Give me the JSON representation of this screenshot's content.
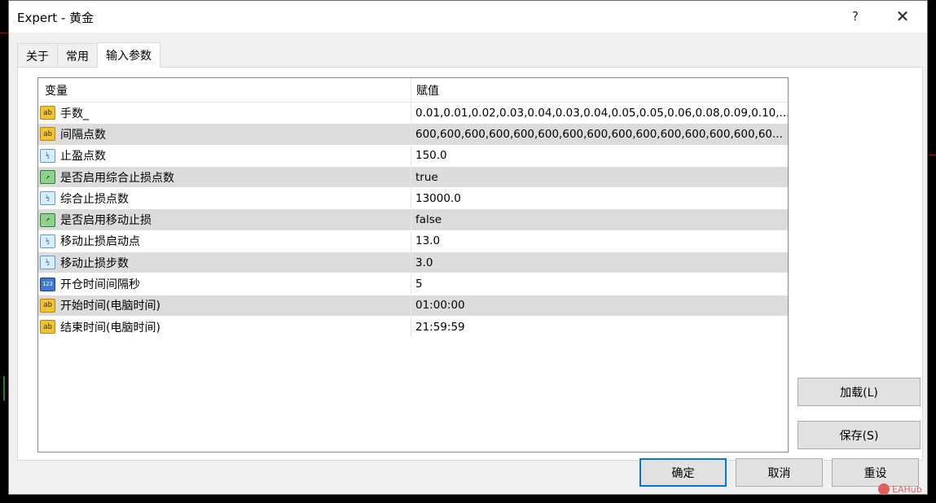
{
  "window": {
    "title": "Expert - 黄金",
    "help_label": "?",
    "close_label": "✕"
  },
  "tabs": [
    {
      "label": "关于"
    },
    {
      "label": "常用"
    },
    {
      "label": "输入参数"
    }
  ],
  "active_tab": "输入参数",
  "grid": {
    "headers": {
      "variable": "变量",
      "value": "赋值"
    },
    "rows": [
      {
        "type": "str",
        "icon_text": "ab",
        "name": "手数_",
        "value": "0.01,0.01,0.02,0.03,0.04,0.03,0.04,0.05,0.05,0.06,0.08,0.09,0.10,..."
      },
      {
        "type": "str",
        "icon_text": "ab",
        "name": "间隔点数",
        "value": "600,600,600,600,600,600,600,600,600,600,600,600,600,600,60..."
      },
      {
        "type": "dbl",
        "icon_text": "½",
        "name": "止盈点数",
        "value": "150.0"
      },
      {
        "type": "bool",
        "icon_text": "↗",
        "name": "是否启用综合止损点数",
        "value": "true"
      },
      {
        "type": "dbl",
        "icon_text": "½",
        "name": "综合止损点数",
        "value": "13000.0"
      },
      {
        "type": "bool",
        "icon_text": "↗",
        "name": "是否启用移动止损",
        "value": "false"
      },
      {
        "type": "dbl",
        "icon_text": "½",
        "name": "移动止损启动点",
        "value": "13.0"
      },
      {
        "type": "dbl",
        "icon_text": "½",
        "name": "移动止损步数",
        "value": "3.0"
      },
      {
        "type": "int",
        "icon_text": "123",
        "name": "开仓时间间隔秒",
        "value": "5"
      },
      {
        "type": "str",
        "icon_text": "ab",
        "name": "开始时间(电脑时间)",
        "value": "01:00:00"
      },
      {
        "type": "str",
        "icon_text": "ab",
        "name": "结束时间(电脑时间)",
        "value": "21:59:59"
      }
    ]
  },
  "buttons": {
    "load": "加载(L)",
    "save": "保存(S)",
    "ok": "确定",
    "cancel": "取消",
    "reset": "重设"
  },
  "watermark": "EAHub"
}
